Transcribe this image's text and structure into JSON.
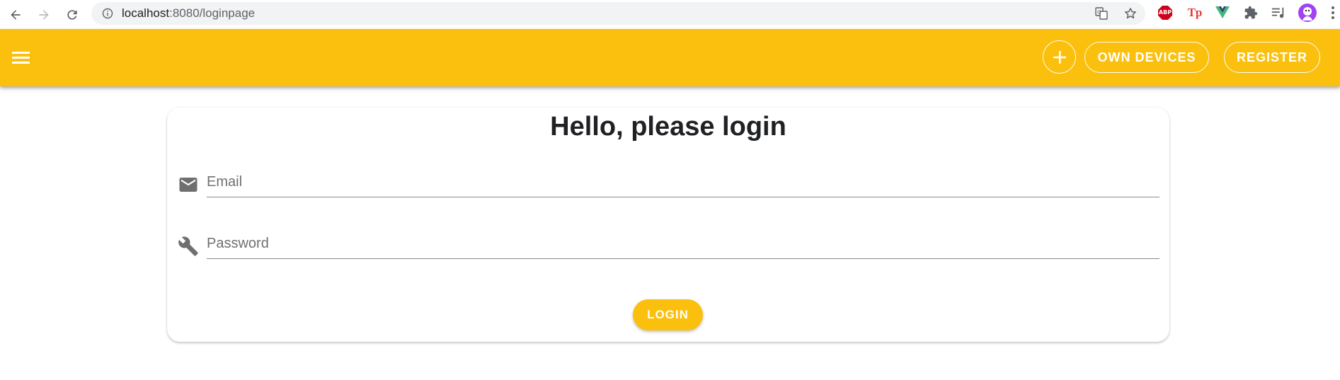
{
  "browser": {
    "url_host": "localhost",
    "url_path": ":8080/loginpage",
    "extensions": {
      "abp_label": "ABP",
      "tp_label": "Tp"
    },
    "icons": {
      "back": "arrow-left-icon",
      "forward": "arrow-right-icon",
      "reload": "reload-icon",
      "info": "info-icon",
      "translate": "translate-icon",
      "bookmark": "star-icon",
      "vue": "vue-icon",
      "extensions": "puzzle-icon",
      "reading_list": "reading-list-icon",
      "profile": "avatar-icon",
      "more": "more-vert-icon"
    }
  },
  "appbar": {
    "color": "#fbc00d",
    "menu_icon": "menu-icon",
    "add_icon": "plus-icon",
    "own_devices_label": "OWN DEVICES",
    "register_label": "REGISTER"
  },
  "login": {
    "title": "Hello, please login",
    "email_placeholder": "Email",
    "email_icon": "email-icon",
    "password_placeholder": "Password",
    "password_icon": "wrench-icon",
    "login_label": "LOGIN"
  }
}
